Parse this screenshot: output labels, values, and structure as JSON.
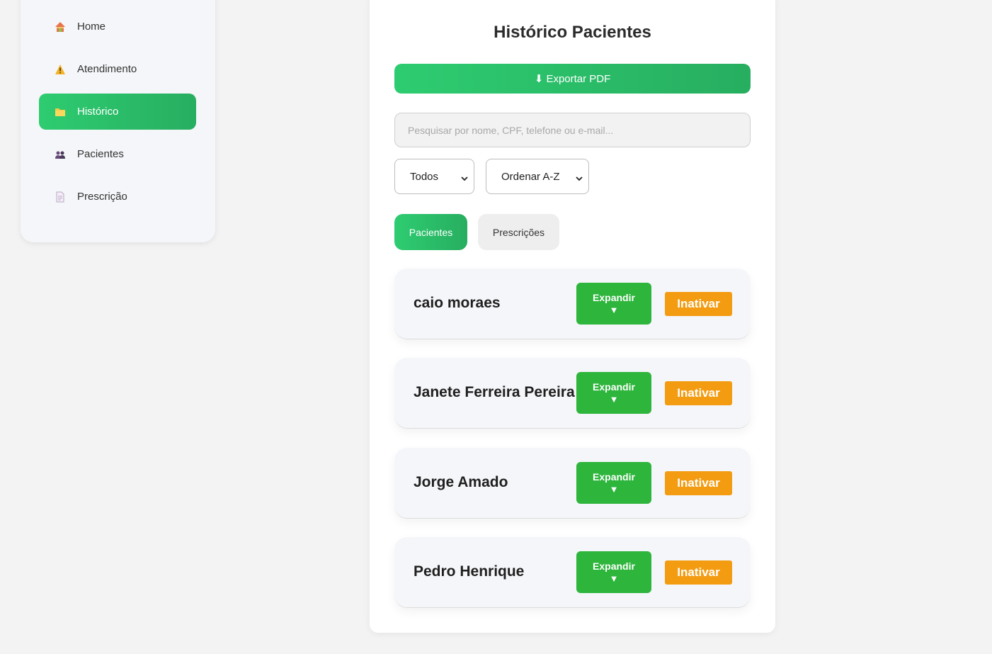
{
  "sidebar": {
    "items": [
      {
        "label": "Home",
        "icon": "house-icon"
      },
      {
        "label": "Atendimento",
        "icon": "warning-icon"
      },
      {
        "label": "Histórico",
        "icon": "folder-icon"
      },
      {
        "label": "Pacientes",
        "icon": "people-icon"
      },
      {
        "label": "Prescrição",
        "icon": "document-icon"
      }
    ],
    "active_index": 2
  },
  "main": {
    "title": "Histórico Pacientes",
    "export_label": "⬇ Exportar PDF",
    "search_placeholder": "Pesquisar por nome, CPF, telefone ou e-mail...",
    "filter_status": "Todos",
    "filter_order": "Ordenar A-Z",
    "tabs": [
      {
        "label": "Pacientes",
        "active": true
      },
      {
        "label": "Prescrições",
        "active": false
      }
    ],
    "expand_label": "Expandir",
    "expand_arrow": "▼",
    "inactivate_label": "Inativar",
    "patients": [
      {
        "name": "caio moraes"
      },
      {
        "name": "Janete Ferreira Pereira"
      },
      {
        "name": "Jorge Amado"
      },
      {
        "name": "Pedro Henrique"
      }
    ]
  },
  "colors": {
    "accent_green": "#2ecc71",
    "expand_green": "#2db53c",
    "inactivate_orange": "#f39c12"
  }
}
